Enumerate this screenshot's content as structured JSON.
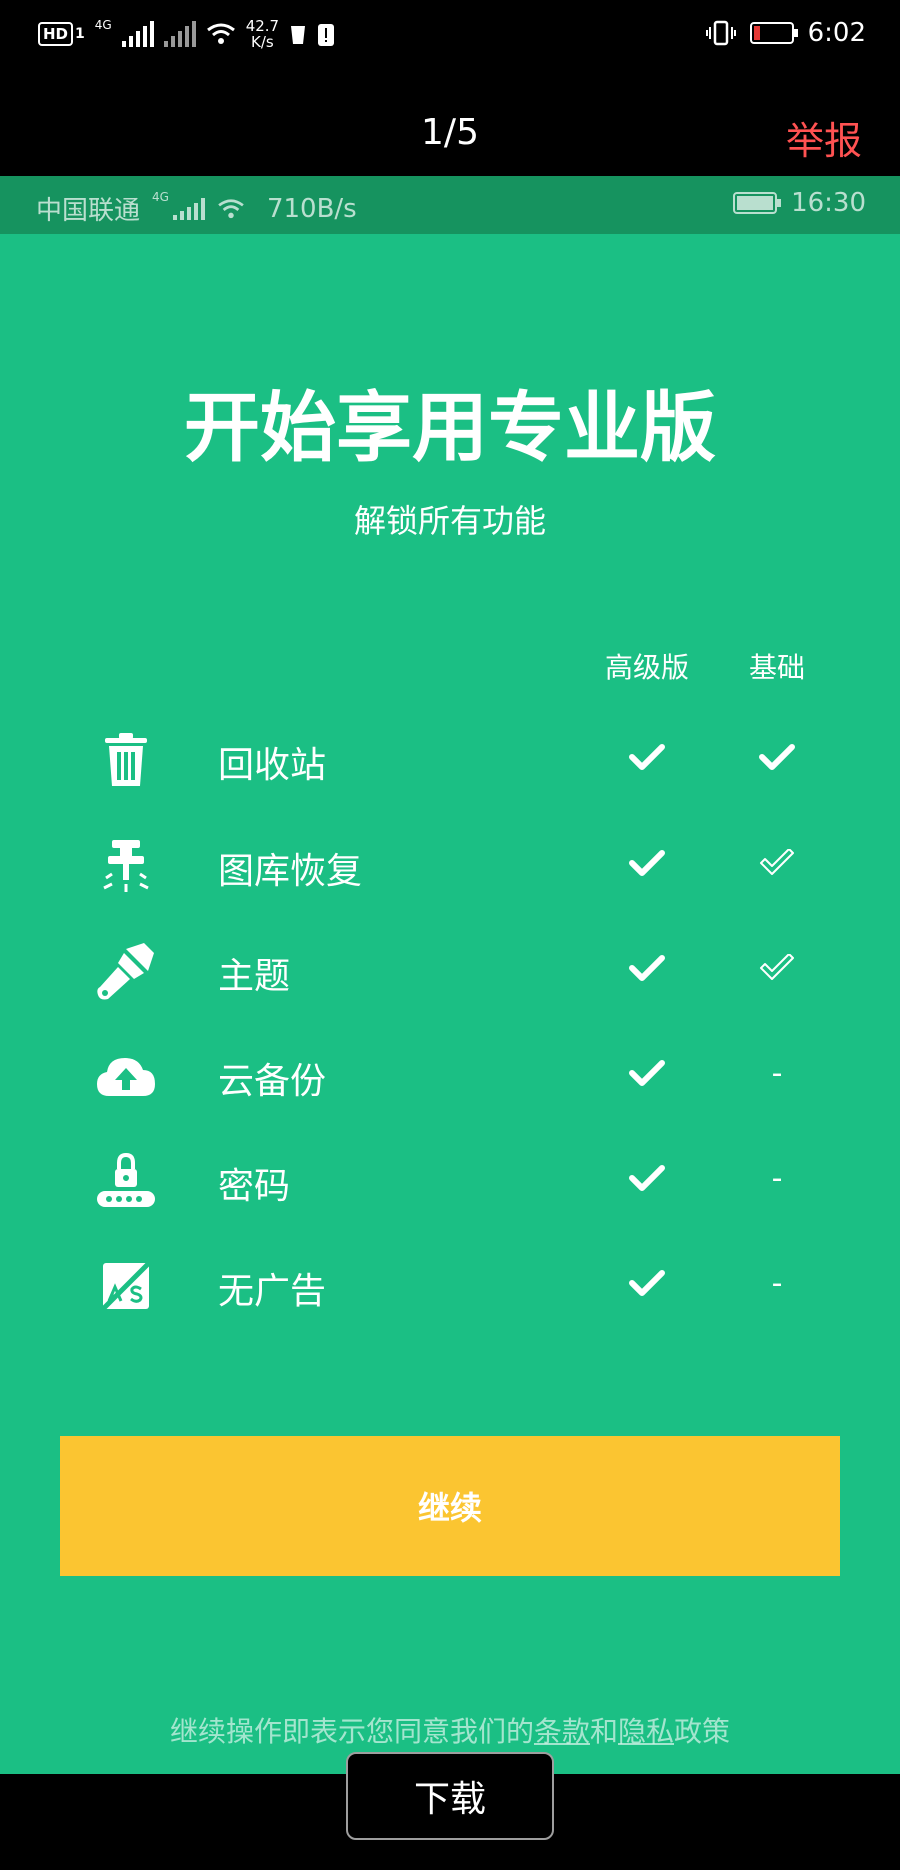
{
  "system_status": {
    "hd_badge": "HD",
    "sim_badge": "1",
    "net_4g": "4G",
    "net_speed_value": "42.7",
    "net_speed_unit": "K/s",
    "time": "6:02",
    "battery_level": 0.1,
    "battery_color": "#e53935"
  },
  "viewer": {
    "page_counter": "1/5",
    "report_label": "举报",
    "report_color": "#ff5252"
  },
  "inner_status": {
    "carrier": "中国联通",
    "net": "4G",
    "speed": "710B/s",
    "time": "16:30"
  },
  "promo": {
    "title": "开始享用专业版",
    "subtitle": "解锁所有功能",
    "columns": {
      "pro": "高级版",
      "basic": "基础"
    },
    "features": [
      {
        "icon": "trash-icon",
        "label": "回收站",
        "pro": "check",
        "basic": "check"
      },
      {
        "icon": "drill-icon",
        "label": "图库恢复",
        "pro": "check",
        "basic": "outline-check"
      },
      {
        "icon": "brush-icon",
        "label": "主题",
        "pro": "check",
        "basic": "outline-check"
      },
      {
        "icon": "cloud-upload-icon",
        "label": "云备份",
        "pro": "check",
        "basic": "-"
      },
      {
        "icon": "lock-password-icon",
        "label": "密码",
        "pro": "check",
        "basic": "-"
      },
      {
        "icon": "no-ads-icon",
        "label": "无广告",
        "pro": "check",
        "basic": "-"
      }
    ],
    "continue_label": "继续",
    "terms": {
      "prefix": "继续操作即表示您同意我们的",
      "terms_link": "条款",
      "and": "和",
      "privacy_link": "隐私",
      "suffix": "政策"
    },
    "accent_color": "#1bbf84",
    "button_color": "#fbc531"
  },
  "download_label": "下载"
}
